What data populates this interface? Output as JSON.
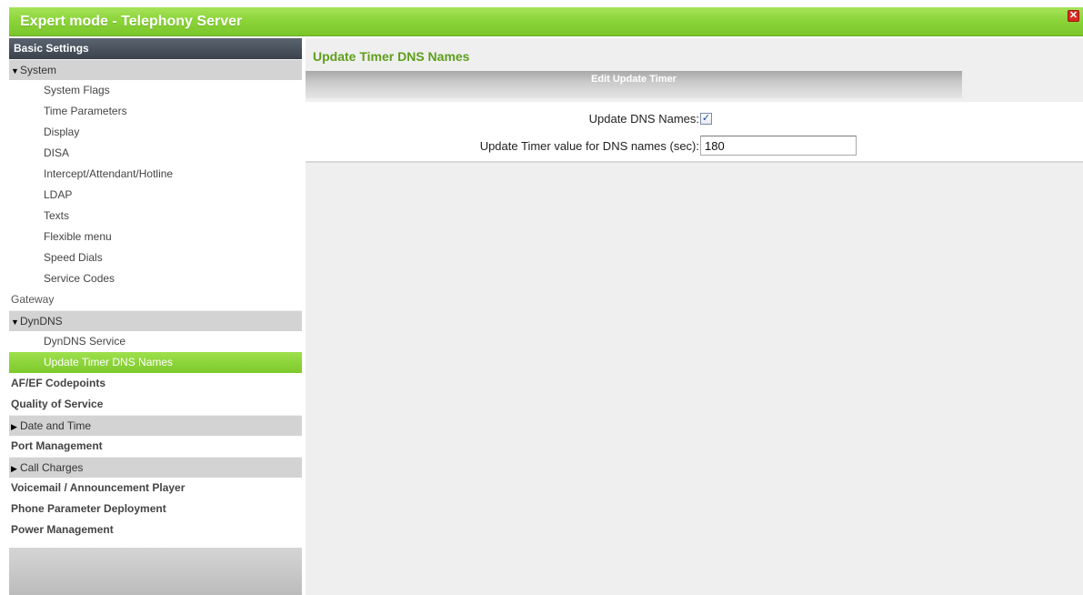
{
  "window": {
    "title": "Expert mode - Telephony Server",
    "close_glyph": "✕"
  },
  "sidebar": {
    "section_title": "Basic Settings",
    "items": [
      {
        "label": "System",
        "kind": "group",
        "expanded": true
      },
      {
        "label": "System Flags",
        "kind": "sub"
      },
      {
        "label": "Time Parameters",
        "kind": "sub"
      },
      {
        "label": "Display",
        "kind": "sub"
      },
      {
        "label": "DISA",
        "kind": "sub"
      },
      {
        "label": "Intercept/Attendant/Hotline",
        "kind": "sub"
      },
      {
        "label": "LDAP",
        "kind": "sub"
      },
      {
        "label": "Texts",
        "kind": "sub"
      },
      {
        "label": "Flexible menu",
        "kind": "sub"
      },
      {
        "label": "Speed Dials",
        "kind": "sub"
      },
      {
        "label": "Service Codes",
        "kind": "sub"
      },
      {
        "label": "Gateway",
        "kind": "top-plain"
      },
      {
        "label": "DynDNS",
        "kind": "group",
        "expanded": true
      },
      {
        "label": "DynDNS Service",
        "kind": "sub"
      },
      {
        "label": "Update Timer DNS Names",
        "kind": "sub",
        "active": true
      },
      {
        "label": "AF/EF Codepoints",
        "kind": "top"
      },
      {
        "label": "Quality of Service",
        "kind": "top"
      },
      {
        "label": "Date and Time",
        "kind": "group",
        "expanded": false
      },
      {
        "label": "Port Management",
        "kind": "top"
      },
      {
        "label": "Call Charges",
        "kind": "group",
        "expanded": false
      },
      {
        "label": "Voicemail / Announcement Player",
        "kind": "top"
      },
      {
        "label": "Phone Parameter Deployment",
        "kind": "top"
      },
      {
        "label": "Power Management",
        "kind": "top"
      }
    ]
  },
  "main": {
    "page_title": "Update Timer DNS Names",
    "section_title": "Edit Update Timer",
    "fields": {
      "update_dns_label": "Update DNS Names:",
      "update_dns_checked": true,
      "timer_label": "Update Timer value for DNS names (sec):",
      "timer_value": "180"
    }
  },
  "colors": {
    "accent_green": "#7ac62a",
    "title_green": "#5f9e1a",
    "sidebar_header": "#3a424c",
    "close_red": "#d62b20"
  }
}
